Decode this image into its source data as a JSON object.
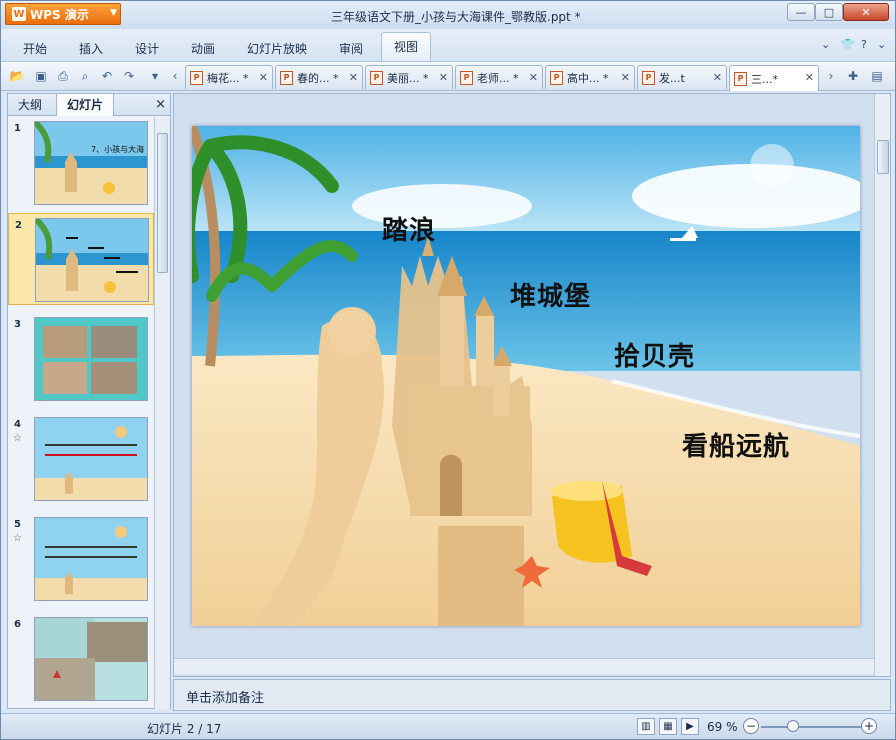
{
  "app": {
    "name": "WPS 演示"
  },
  "window": {
    "title": "三年级语文下册_小孩与大海课件_鄂教版.ppt *"
  },
  "menu": {
    "items": [
      "开始",
      "插入",
      "设计",
      "动画",
      "幻灯片放映",
      "审阅",
      "视图"
    ]
  },
  "tabs": [
    {
      "label": "梅花... *"
    },
    {
      "label": "春的... *"
    },
    {
      "label": "美丽... *"
    },
    {
      "label": "老师... *"
    },
    {
      "label": "高中... *"
    },
    {
      "label": "发...t"
    },
    {
      "label": "三...*"
    }
  ],
  "left_panel": {
    "tab_outline": "大纲",
    "tab_slides": "幻灯片",
    "close": "×"
  },
  "thumbnails": [
    {
      "num": "1",
      "title": "7、小孩与大海"
    },
    {
      "num": "2"
    },
    {
      "num": "3"
    },
    {
      "num": "4",
      "star": "☆"
    },
    {
      "num": "5",
      "star": "☆"
    },
    {
      "num": "6"
    }
  ],
  "slide": {
    "texts": [
      "踏浪",
      "堆城堡",
      "拾贝壳",
      "看船远航"
    ]
  },
  "notes": {
    "placeholder": "单击添加备注"
  },
  "status": {
    "slide_count": "幻灯片 2 / 17",
    "zoom": "69 %"
  },
  "colors": {
    "accent": "#e96d0c",
    "selection": "#fbe7a8"
  }
}
